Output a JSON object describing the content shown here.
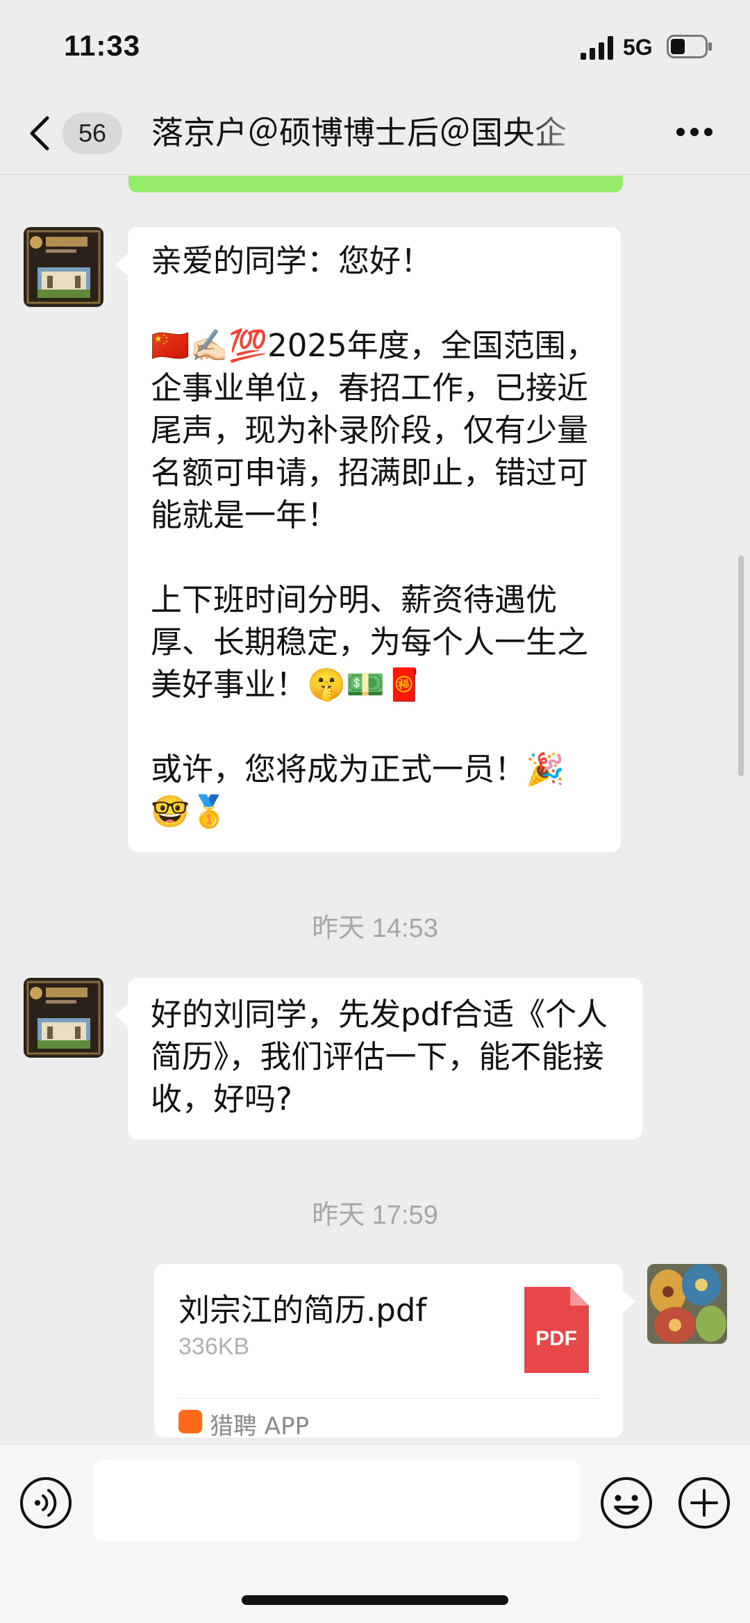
{
  "status_bar": {
    "time": "11:33",
    "network": "5G"
  },
  "header": {
    "unread_count": "56",
    "title": "落京户＠硕博博士后＠国央企",
    "back_icon": "chevron-left-icon",
    "more_icon": "ellipsis-icon"
  },
  "messages": [
    {
      "sender": "other",
      "avatar": "tsinghua-university-avatar",
      "paragraphs": [
        "亲爱的同学：您好！",
        "🇨🇳✍🏻💯2025年度，全国范围，企事业单位，春招工作，已接近尾声，现为补录阶段，仅有少量名额可申请，招满即止，错过可能就是一年！",
        "上下班时间分明、薪资待遇优厚、长期稳定，为每个人一生之美好事业！🤫💵🧧",
        "或许，您将成为正式一员！🎉🤓🥇"
      ]
    },
    {
      "type": "timestamp",
      "text": "昨天 14:53"
    },
    {
      "sender": "other",
      "avatar": "tsinghua-university-avatar",
      "text": "好的刘同学，先发pdf合适《个人简历》，我们评估一下，能不能接收，好吗?"
    },
    {
      "type": "timestamp",
      "text": "昨天 17:59"
    },
    {
      "sender": "me",
      "avatar": "painted-eggs-avatar",
      "file": {
        "name": "刘宗江的简历.pdf",
        "size": "336KB",
        "icon_label": "PDF",
        "source": "猎聘 APP"
      }
    }
  ],
  "input_bar": {
    "placeholder": "",
    "voice_icon": "voice-icon",
    "emoji_icon": "smiley-icon",
    "plus_icon": "plus-icon"
  },
  "colors": {
    "background": "#ededed",
    "bubble_other": "#ffffff",
    "bubble_me_green": "#95ec69",
    "pdf_red": "#e8474a",
    "source_orange": "#ff6a1a"
  }
}
